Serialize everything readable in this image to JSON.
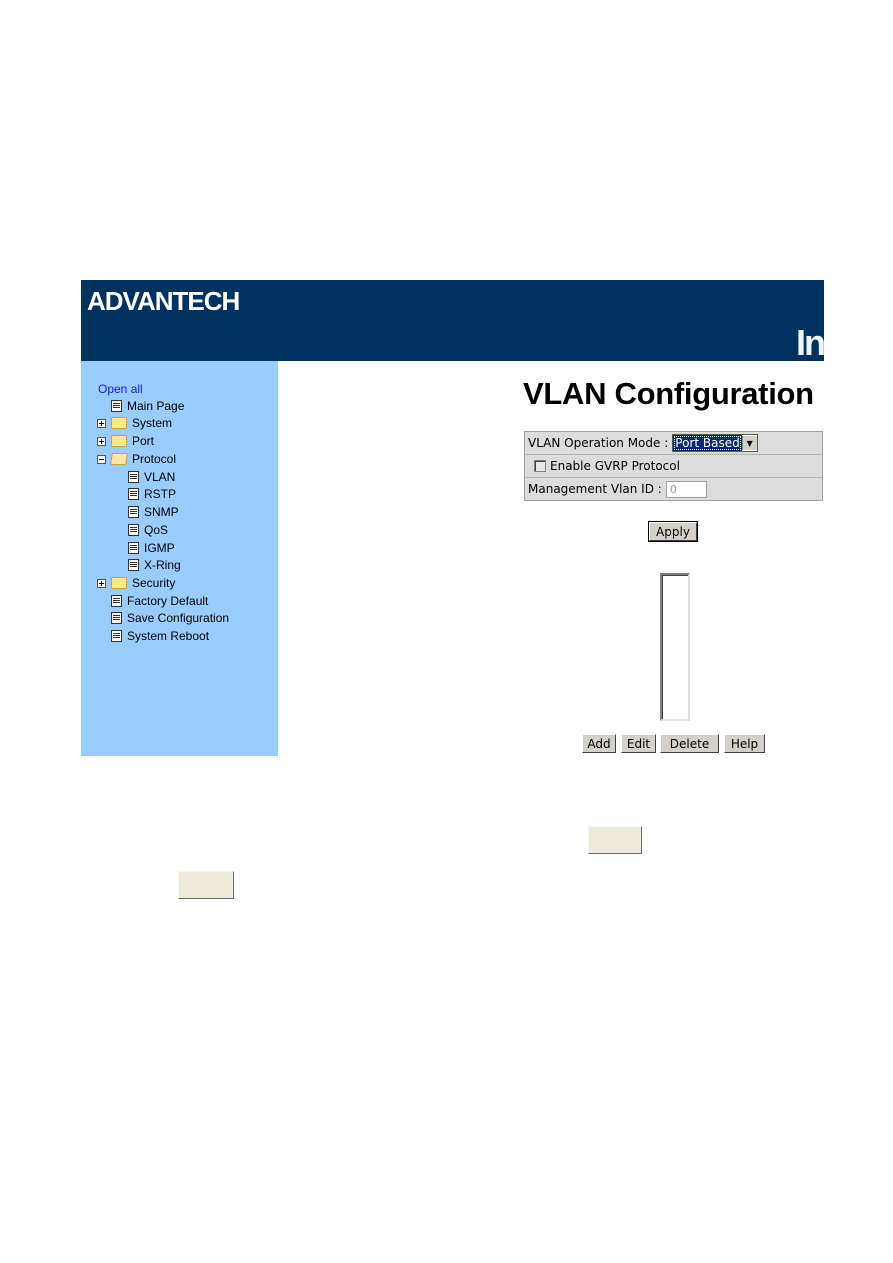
{
  "header": {
    "logo": "ADVANTECH",
    "title_fragment": "In",
    "bg_color": "#00325f"
  },
  "sidebar": {
    "bg_color": "#99ccff",
    "open_all": "Open all",
    "items": [
      {
        "label": "Main Page",
        "type": "page",
        "level": 0
      },
      {
        "label": "System",
        "type": "folder",
        "expanded": false,
        "level": 0
      },
      {
        "label": "Port",
        "type": "folder",
        "expanded": false,
        "level": 0
      },
      {
        "label": "Protocol",
        "type": "folder",
        "expanded": true,
        "level": 0
      },
      {
        "label": "VLAN",
        "type": "page",
        "level": 1
      },
      {
        "label": "RSTP",
        "type": "page",
        "level": 1
      },
      {
        "label": "SNMP",
        "type": "page",
        "level": 1
      },
      {
        "label": "QoS",
        "type": "page",
        "level": 1
      },
      {
        "label": "IGMP",
        "type": "page",
        "level": 1
      },
      {
        "label": "X-Ring",
        "type": "page",
        "level": 1
      },
      {
        "label": "Security",
        "type": "folder",
        "expanded": false,
        "level": 0
      },
      {
        "label": "Factory Default",
        "type": "page",
        "level": 0
      },
      {
        "label": "Save Configuration",
        "type": "page",
        "level": 0
      },
      {
        "label": "System Reboot",
        "type": "page",
        "level": 0
      }
    ]
  },
  "main": {
    "title": "VLAN Configuration",
    "form": {
      "mode_label": "VLAN Operation Mode :",
      "mode_value": "Port Based",
      "gvrp_label": "Enable GVRP Protocol",
      "gvrp_checked": false,
      "mgmt_label": "Management Vlan ID :",
      "mgmt_value": "0"
    },
    "apply_label": "Apply",
    "vlan_list": [],
    "buttons": {
      "add": "Add",
      "edit": "Edit",
      "delete": "Delete",
      "help": "Help"
    }
  }
}
